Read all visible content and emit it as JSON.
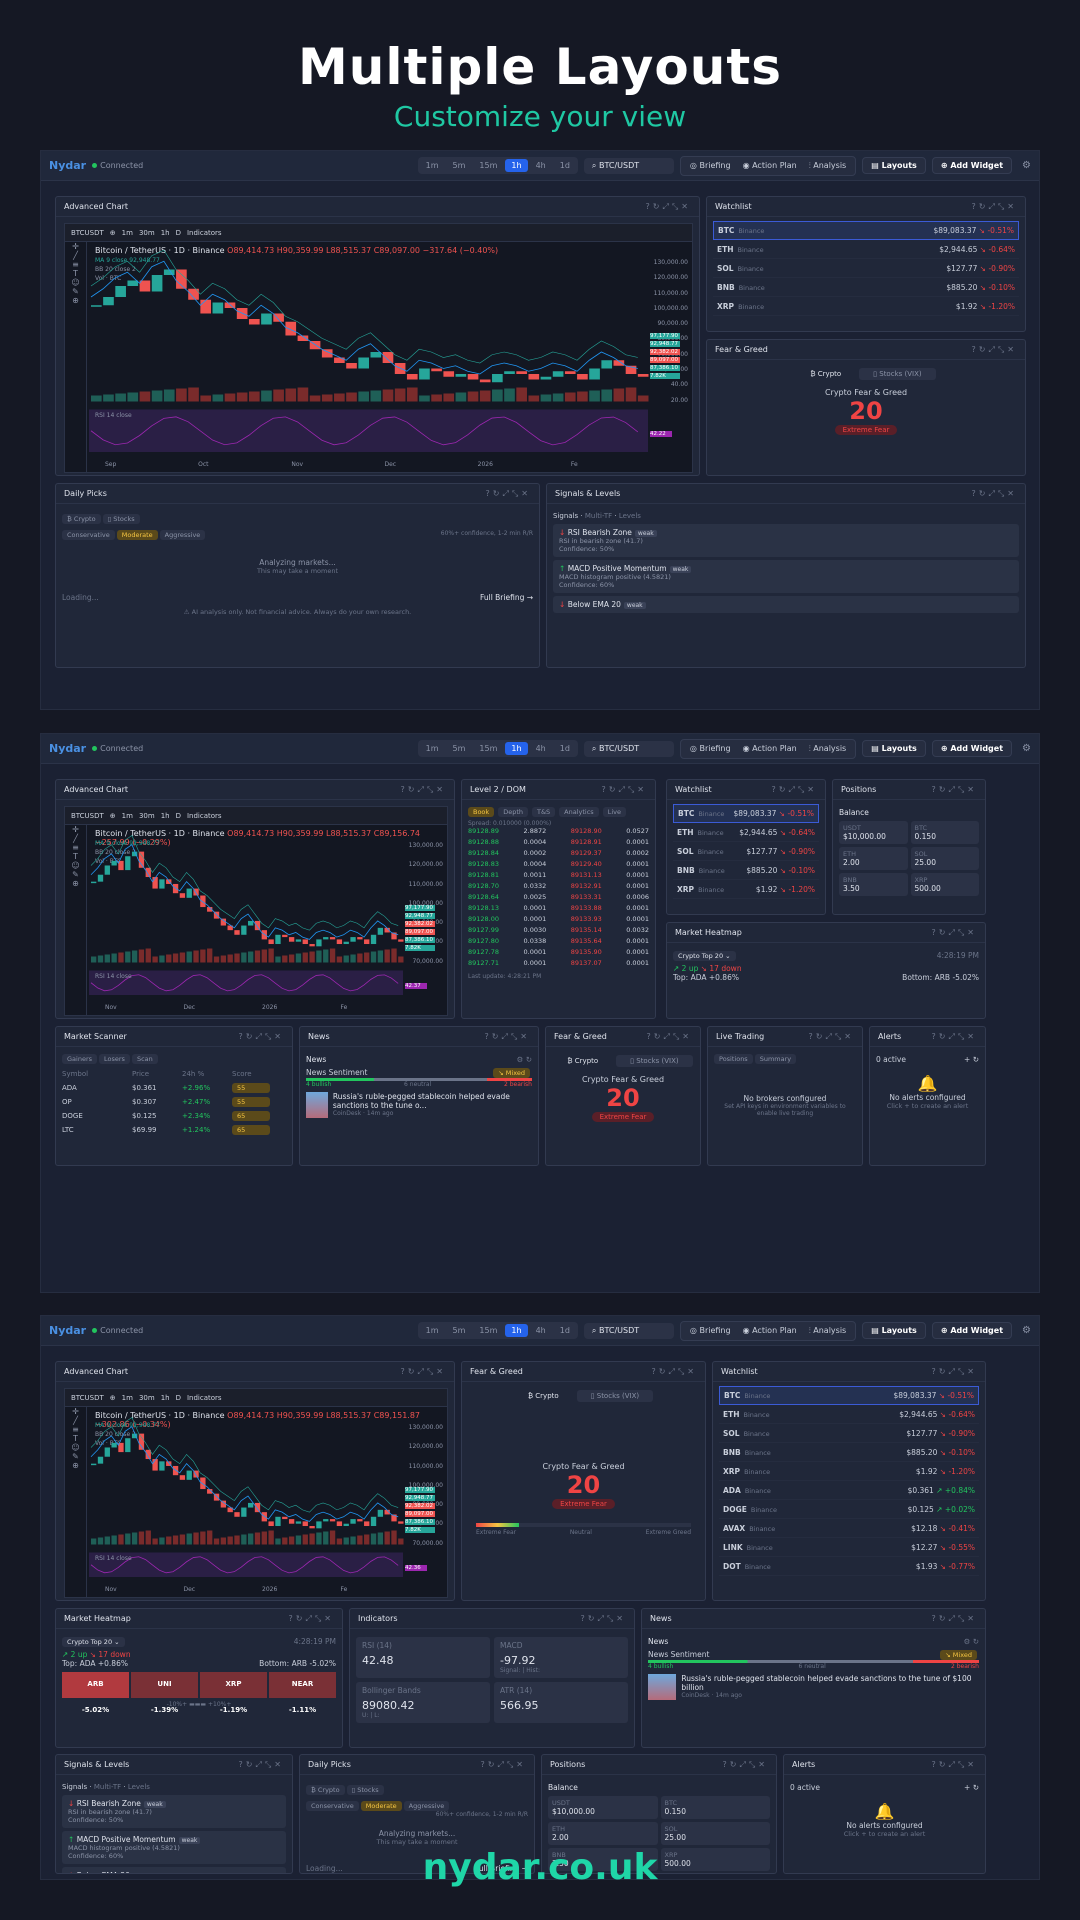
{
  "hero": {
    "title": "Multiple Layouts",
    "subtitle": "Customize your view"
  },
  "footer": "nydar.co.uk",
  "app": {
    "logo": "Nydar",
    "status": "Connected",
    "timeframes": [
      "1m",
      "5m",
      "15m",
      "1h",
      "4h",
      "1d"
    ],
    "active_tf": "1h",
    "symbol": "BTC/USDT",
    "briefing": "Briefing",
    "action_plan": "Action Plan",
    "analysis": "Analysis",
    "layouts": "Layouts",
    "add_widget": "Add Widget"
  },
  "panels": {
    "advanced_chart": "Advanced Chart",
    "watchlist": "Watchlist",
    "fear_greed": "Fear & Greed",
    "daily_picks": "Daily Picks",
    "signals_levels": "Signals & Levels",
    "level2": "Level 2 / DOM",
    "positions": "Positions",
    "market_heatmap": "Market Heatmap",
    "market_scanner": "Market Scanner",
    "news": "News",
    "live_trading": "Live Trading",
    "alerts": "Alerts",
    "indicators": "Indicators"
  },
  "chart": {
    "symbol": "BTCUSDT",
    "intervals": [
      "1m",
      "30m",
      "1h",
      "D"
    ],
    "indicators": "Indicators",
    "title": "Bitcoin / TetherUS · 1D · Binance",
    "ohlc": "O89,414.73 H90,359.99 L88,515.37 C89,097.00 −317.64 (−0.40%)",
    "ohlc2": "O89,414.73 H90,359.99 L88,515.37 C89,156.74 −257.99 (−0.29%)",
    "ohlc3": "O89,414.73 H90,359.99 L88,515.37 C89,151.87 −302.86 (−0.34%)",
    "ma": "MA 9 close",
    "ma_val": "92,948.77",
    "bb": "BB 20 close 2",
    "vol": "Vol · BTC",
    "rsi": "RSI 14 close",
    "rsi_val": "42.22",
    "rsi_val2": "42.37",
    "rsi_val3": "42.36",
    "yticks": [
      "130,000.00",
      "120,000.00",
      "110,000.00",
      "100,000.00",
      "90,000.00",
      "80,000.00",
      "70,000.00",
      "60,000.00",
      "40.00",
      "20.00"
    ],
    "xticks": [
      "Sep",
      "Oct",
      "Nov",
      "Dec",
      "2026",
      "Fe"
    ],
    "xticks2": [
      "Nov",
      "Dec",
      "2026",
      "Fe"
    ],
    "price_tags": [
      "97,177.90",
      "92,948.77",
      "92,382.02",
      "89,097.00",
      "87,386.10",
      "7.82K"
    ],
    "candles": [
      115,
      118,
      122,
      124,
      120,
      126,
      128,
      121,
      117,
      112,
      116,
      114,
      110,
      108,
      112,
      109,
      104,
      102,
      99,
      96,
      94,
      92,
      96,
      98,
      94,
      90,
      88,
      92,
      91,
      89,
      90,
      88,
      87,
      90,
      91,
      90,
      88,
      89,
      91,
      90,
      88,
      92,
      95,
      93,
      90,
      89
    ]
  },
  "watchlist": {
    "items": [
      {
        "sym": "BTC",
        "ex": "Binance",
        "price": "$89,083.37",
        "chg": "↘ -0.51%",
        "dir": "neg"
      },
      {
        "sym": "ETH",
        "ex": "Binance",
        "price": "$2,944.65",
        "chg": "↘ -0.64%",
        "dir": "neg"
      },
      {
        "sym": "SOL",
        "ex": "Binance",
        "price": "$127.77",
        "chg": "↘ -0.90%",
        "dir": "neg"
      },
      {
        "sym": "BNB",
        "ex": "Binance",
        "price": "$885.20",
        "chg": "↘ -0.10%",
        "dir": "neg"
      },
      {
        "sym": "XRP",
        "ex": "Binance",
        "price": "$1.92",
        "chg": "↘ -1.20%",
        "dir": "neg"
      },
      {
        "sym": "ADA",
        "ex": "Binance",
        "price": "$0.361",
        "chg": "↗ +0.84%",
        "dir": "pos"
      },
      {
        "sym": "DOGE",
        "ex": "Binance",
        "price": "$0.125",
        "chg": "↗ +0.02%",
        "dir": "pos"
      },
      {
        "sym": "AVAX",
        "ex": "Binance",
        "price": "$12.18",
        "chg": "↘ -0.41%",
        "dir": "neg"
      },
      {
        "sym": "LINK",
        "ex": "Binance",
        "price": "$12.27",
        "chg": "↘ -0.55%",
        "dir": "neg"
      },
      {
        "sym": "DOT",
        "ex": "Binance",
        "price": "$1.93",
        "chg": "↘ -0.77%",
        "dir": "neg"
      }
    ]
  },
  "fear_greed": {
    "tab_crypto": "₿ Crypto",
    "tab_stocks": "▯ Stocks (VIX)",
    "label": "Crypto Fear & Greed",
    "value": "20",
    "status": "Extreme Fear",
    "scale": [
      "Extreme Fear",
      "Neutral",
      "Extreme Greed"
    ]
  },
  "daily_picks": {
    "tab_crypto": "₿ Crypto",
    "tab_stocks": "▯ Stocks",
    "risk": [
      "Conservative",
      "Moderate",
      "Aggressive"
    ],
    "conf": "60%+ confidence, 1-2 min R/R",
    "analyzing": "Analyzing markets...",
    "moment": "This may take a moment",
    "loading": "Loading...",
    "full": "Full Briefing →",
    "disclaimer": "⚠ AI analysis only. Not financial advice. Always do your own research."
  },
  "signals": {
    "tabs": [
      "Signals",
      "Multi-TF",
      "Levels"
    ],
    "items": [
      {
        "title": "RSI Bearish Zone",
        "badge": "weak",
        "sub": "RSI in bearish zone (41.7)",
        "conf": "Confidence: 50%",
        "dir": "neg"
      },
      {
        "title": "MACD Positive Momentum",
        "badge": "weak",
        "sub": "MACD histogram positive (4.5821)",
        "conf": "Confidence: 60%",
        "dir": "pos"
      },
      {
        "title": "Below EMA 20",
        "badge": "weak",
        "sub": "",
        "conf": "",
        "dir": "neg"
      }
    ]
  },
  "dom": {
    "tabs": [
      "Book",
      "Depth",
      "T&S",
      "Analytics"
    ],
    "spread": "Spread: 0.010000 (0.000%)",
    "live": "Live",
    "cols": [
      "Price",
      "Size",
      "Price",
      "Size"
    ],
    "rows": [
      [
        "89128.89",
        "2.8872",
        "89128.90",
        "0.0527"
      ],
      [
        "89128.88",
        "0.0004",
        "89128.91",
        "0.0001"
      ],
      [
        "89128.84",
        "0.0002",
        "89129.37",
        "0.0002"
      ],
      [
        "89128.83",
        "0.0004",
        "89129.40",
        "0.0001"
      ],
      [
        "89128.81",
        "0.0011",
        "89131.13",
        "0.0001"
      ],
      [
        "89128.70",
        "0.0332",
        "89132.91",
        "0.0001"
      ],
      [
        "89128.64",
        "0.0025",
        "89133.31",
        "0.0006"
      ],
      [
        "89128.13",
        "0.0001",
        "89133.88",
        "0.0001"
      ],
      [
        "89128.00",
        "0.0001",
        "89133.93",
        "0.0001"
      ],
      [
        "89127.99",
        "0.0030",
        "89135.14",
        "0.0032"
      ],
      [
        "89127.80",
        "0.0338",
        "89135.64",
        "0.0001"
      ],
      [
        "89127.78",
        "0.0001",
        "89135.90",
        "0.0001"
      ],
      [
        "89127.71",
        "0.0001",
        "89137.07",
        "0.0001"
      ]
    ],
    "updated": "Last update: 4:28:21 PM",
    "pair": "BTC/USDT"
  },
  "positions": {
    "title": "Balance",
    "items": [
      {
        "k": "USDT",
        "v": "$10,000.00"
      },
      {
        "k": "BTC",
        "v": "0.150"
      },
      {
        "k": "ETH",
        "v": "2.00"
      },
      {
        "k": "SOL",
        "v": "25.00"
      },
      {
        "k": "BNB",
        "v": "3.50"
      },
      {
        "k": "XRP",
        "v": "500.00"
      }
    ]
  },
  "heatmap": {
    "select": "Crypto Top 20",
    "time": "4:28:19 PM",
    "up": "↗ 2 up",
    "down": "↘ 17 down",
    "top": "Top: ADA +0.86%",
    "bottom": "Bottom: ARB -5.02%",
    "tiles": [
      {
        "s": "ARB",
        "c": "-5.02%"
      },
      {
        "s": "UNI",
        "c": "-1.39%"
      },
      {
        "s": "XRP",
        "c": "-1.19%"
      },
      {
        "s": "NEAR",
        "c": "-1.11%"
      }
    ],
    "legend_l": "-10%+",
    "legend_r": "+10%+"
  },
  "scanner": {
    "tabs": [
      "Gainers",
      "Losers",
      "Scan"
    ],
    "cols": [
      "Symbol",
      "Price",
      "24h %",
      "Score"
    ],
    "rows": [
      [
        "ADA",
        "$0.361",
        "+2.96%",
        "55"
      ],
      [
        "OP",
        "$0.307",
        "+2.47%",
        "55"
      ],
      [
        "DOGE",
        "$0.125",
        "+2.34%",
        "65"
      ],
      [
        "LTC",
        "$69.99",
        "+1.24%",
        "65"
      ]
    ]
  },
  "news": {
    "title": "News",
    "sentiment": "News Sentiment",
    "mixed": "↘ Mixed",
    "bullish": "4 bullish",
    "neutral": "6 neutral",
    "bearish": "2 bearish",
    "headline": "Russia's ruble-pegged stablecoin helped evade sanctions to the tune o...",
    "headline_full": "Russia's ruble-pegged stablecoin helped evade sanctions to the tune of $100 billion",
    "source": "CoinDesk",
    "ago": "14m ago"
  },
  "live_trading": {
    "tabs": [
      "Positions",
      "Summary"
    ],
    "none": "No brokers configured",
    "hint": "Set API keys in environment variables to enable live trading"
  },
  "alerts": {
    "active": "0 active",
    "none": "No alerts configured",
    "hint": "Click + to create an alert"
  },
  "indicators": {
    "items": [
      {
        "k": "RSI (14)",
        "v": "42.48",
        "sub": ""
      },
      {
        "k": "MACD",
        "v": "-97.92",
        "sub": "Signal: | Hist:"
      },
      {
        "k": "Bollinger Bands",
        "v": "89080.42",
        "sub": "U: | L:"
      },
      {
        "k": "ATR (14)",
        "v": "566.95",
        "sub": ""
      }
    ]
  }
}
